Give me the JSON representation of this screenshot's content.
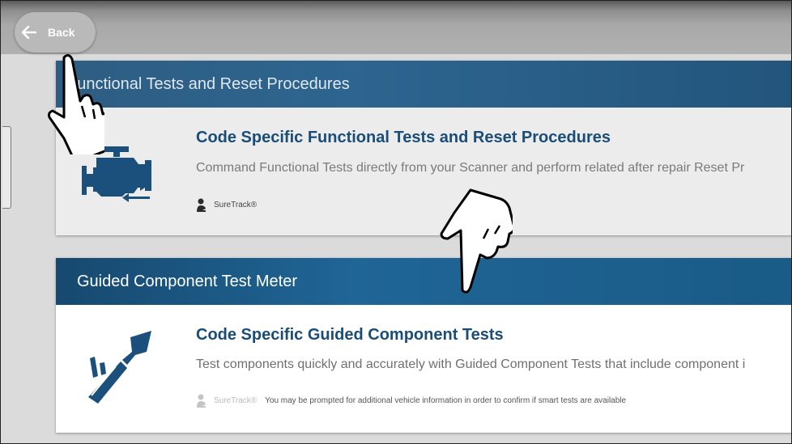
{
  "back_button": {
    "label": "Back",
    "icon": "arrow-left-icon"
  },
  "cards": [
    {
      "header": "Functional Tests and Reset Procedures",
      "title": "Code Specific Functional Tests and Reset Procedures",
      "description": "Command Functional Tests directly from your Scanner and perform related after repair Reset Pr",
      "icon": "engine-icon",
      "suretrack_label": "SureTrack®",
      "suretrack_icon": "suretrack-icon",
      "note": ""
    },
    {
      "header": "Guided Component Test Meter",
      "title": "Code Specific Guided Component Tests",
      "description": "Test components quickly and accurately with Guided Component Tests that include component i",
      "icon": "test-probe-icon",
      "suretrack_label": "SureTrack®",
      "suretrack_icon": "suretrack-icon",
      "note": "You may be prompted for additional vehicle information in order to confirm if smart tests are available"
    }
  ],
  "colors": {
    "header_blue": "#1f6596",
    "title_blue": "#1a4d78",
    "icon_blue": "#1b4f7c"
  }
}
